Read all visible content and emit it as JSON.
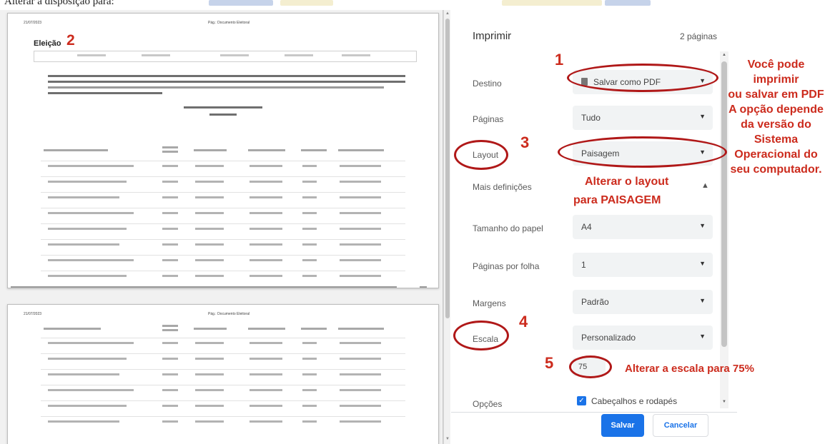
{
  "top_caption": {
    "text": "Alterar a disposição para:"
  },
  "preview": {
    "page_heading": "Eleição",
    "annotation_number": "2",
    "header_left": "21/07/2023",
    "header_center": "Pág.: Documento Eleitoral"
  },
  "panel": {
    "title": "Imprimir",
    "page_count": "2 páginas",
    "rows": {
      "destination": {
        "label": "Destino",
        "value": "Salvar como PDF"
      },
      "pages": {
        "label": "Páginas",
        "value": "Tudo"
      },
      "layout": {
        "label": "Layout",
        "value": "Paisagem"
      },
      "more_settings": {
        "label": "Mais definições"
      },
      "paper_size": {
        "label": "Tamanho do papel",
        "value": "A4"
      },
      "pages_per_sheet": {
        "label": "Páginas por folha",
        "value": "1"
      },
      "margins": {
        "label": "Margens",
        "value": "Padrão"
      },
      "scale": {
        "label": "Escala",
        "value": "Personalizado"
      },
      "scale_input": {
        "value": "75"
      },
      "options": {
        "label": "Opções",
        "checkbox_label": "Cabeçalhos e rodapés",
        "checked": true
      }
    },
    "buttons": {
      "save": "Salvar",
      "cancel": "Cancelar"
    }
  },
  "annotations": {
    "n1": "1",
    "n3": "3",
    "n4": "4",
    "n5": "5",
    "layout_note": [
      "Alterar o layout",
      "para PAISAGEM"
    ],
    "scale_note": "Alterar a escala para 75%",
    "side_note": [
      "Você pode",
      "imprimir",
      "ou salvar em PDF",
      "A opção depende",
      "da versão do",
      "Sistema",
      "Operacional do",
      "seu computador."
    ]
  },
  "colors": {
    "annotation_red": "#cc2b1d",
    "oval_red": "#b01818",
    "primary_blue": "#1a73e8"
  },
  "icons": {
    "pdf": "pdf-file-icon",
    "dropdown": "chevron-down-icon",
    "expand": "chevron-up-icon",
    "check": "checkbox-checked-icon"
  }
}
